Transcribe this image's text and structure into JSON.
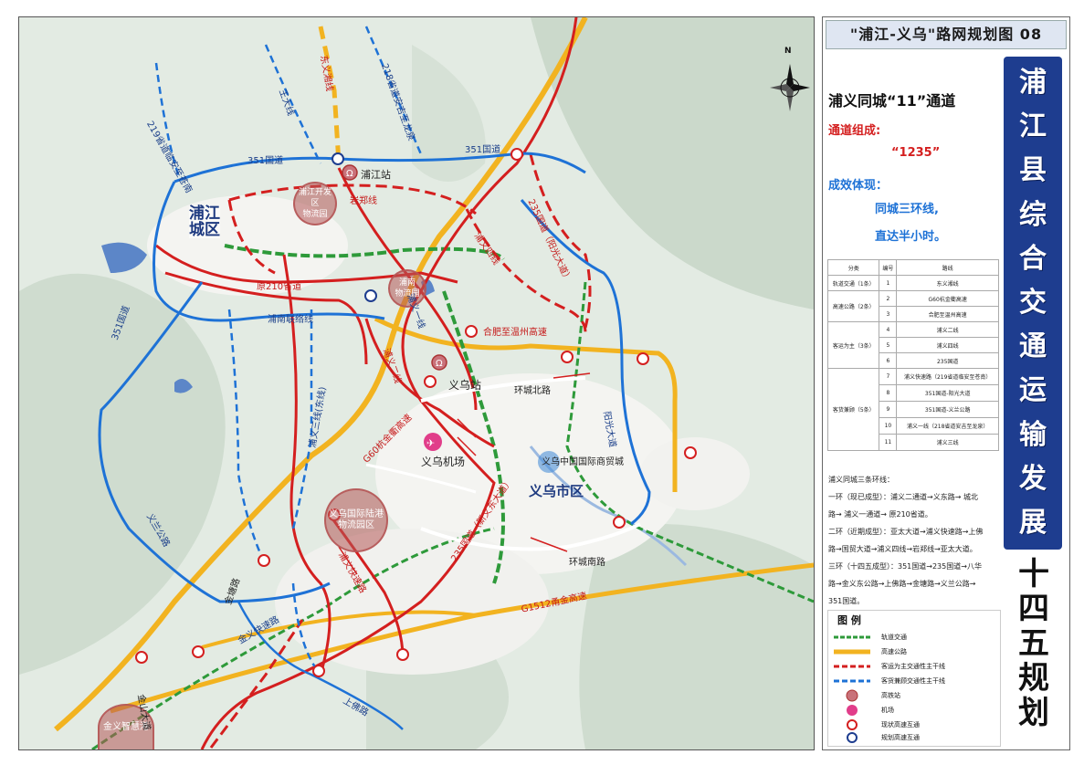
{
  "banner": "\"浦江-义乌\"路网规划图 08",
  "vertical_title": [
    "浦",
    "江",
    "县",
    "综",
    "合",
    "交",
    "通",
    "运",
    "输",
    "发",
    "展"
  ],
  "vertical_title2": [
    "十",
    "四",
    "五",
    "规",
    "划"
  ],
  "subtitle": "浦义同城“11”通道",
  "section_composition": "通道组成:",
  "composition_value": "“1235”",
  "section_effect": "成效体现：",
  "effect_line1": "同城三环线,",
  "effect_line2": "直达半小时。",
  "table": {
    "headers": [
      "分类",
      "编号",
      "路线"
    ],
    "rows": [
      {
        "cat": "轨道交通（1条）",
        "num": "1",
        "route": "东义湘线"
      },
      {
        "cat": "高速公路（2条）",
        "num": "2",
        "route": "G60杭金衢高速"
      },
      {
        "cat": "",
        "num": "3",
        "route": "合肥至温州高速"
      },
      {
        "cat": "客运为主（3条）",
        "num": "4",
        "route": "浦义二线"
      },
      {
        "cat": "",
        "num": "5",
        "route": "浦义四线"
      },
      {
        "cat": "",
        "num": "6",
        "route": "235国道"
      },
      {
        "cat": "客货兼顾（5条）",
        "num": "7",
        "route": "浦义快速路（219省道临安至苍南）"
      },
      {
        "cat": "",
        "num": "8",
        "route": "351国道-阳光大道"
      },
      {
        "cat": "",
        "num": "9",
        "route": "351国道-义兰公路"
      },
      {
        "cat": "",
        "num": "10",
        "route": "浦义一线（218省道安吉至龙泉）"
      },
      {
        "cat": "",
        "num": "11",
        "route": "浦义三线"
      }
    ]
  },
  "notes": [
    "浦义同城三条环线：",
    "一环（现已成型）：浦义二通道→义东路→ 城北",
    "路→ 浦义一通道→ 原210省道。",
    "二环（近期成型）：亚太大道→浦义快速路→上佛",
    "路→国贸大道→浦义四线→岩郑线→亚太大道。",
    "三环（十四五成型）：351国道→235国道→八华",
    "路→金义东公路→上佛路→金塘路→义兰公路→",
    "351国道。"
  ],
  "legend": {
    "title": "图 例",
    "items": [
      {
        "label": "轨道交通",
        "type": "rail"
      },
      {
        "label": "高速公路",
        "type": "highway"
      },
      {
        "label": "客运为主交通性主干线",
        "type": "passenger"
      },
      {
        "label": "客货兼顾交通性主干线",
        "type": "mixed"
      },
      {
        "label": "高铁站",
        "type": "station"
      },
      {
        "label": "机场",
        "type": "airport"
      },
      {
        "label": "现状高速互通",
        "type": "interchange-existing"
      },
      {
        "label": "规划高速互通",
        "type": "interchange-planned"
      }
    ]
  },
  "map_labels": {
    "north": "N",
    "pujiang_city": "浦江\n城区",
    "pujiang_station": "浦江站",
    "yiwu_station": "义乌站",
    "yiwu_airport": "义乌机场",
    "yiwu_city": "义乌市区",
    "trade_city": "义乌中国国际商贸城",
    "pujiang_dev": "浦江开发区\n物流园",
    "punan_logistics": "浦南\n物流园",
    "yiwu_port": "义乌国际陆港\n物流园区",
    "jinyi_hub": "金义智慧港",
    "g351_top": "351国道",
    "g351_top2": "351国道",
    "g351_left": "351国道",
    "yanzheng": "岩郑线",
    "yuan210": "原210省道",
    "punan_link": "浦南联络线",
    "g235": "235国道（阳光大道）",
    "g235_lower": "235国道（新义东大道）",
    "pu4": "浦义四线",
    "pu2": "浦义二线",
    "pu3": "浦义三线(东线)",
    "pu1": "浦义一线",
    "pu_fast": "浦义快速路",
    "hz_wz": "合肥至温州高速",
    "g60": "G60杭金衢高速",
    "g1512": "G1512甬金高速",
    "huancheng_north": "环城北路",
    "huancheng_south": "环城南路",
    "yangguang": "阳光大道",
    "yilan": "义兰公路",
    "s219": "219省道临安至苍南",
    "s218": "218省道安吉至龙泉",
    "shangfo": "上佛路",
    "jinyi_fast": "金义快速路",
    "jintang": "金塘路",
    "jinshan": "金山大道",
    "dongyang_rail": "东义湘线",
    "wangdao": "王大线"
  },
  "colors": {
    "title_bg": "#1e3d8f",
    "highway": "#f2b320",
    "passenger": "#d41f1f",
    "mixed": "#1e72d6",
    "rail": "#2e9a3a",
    "badge": "#b55858"
  }
}
